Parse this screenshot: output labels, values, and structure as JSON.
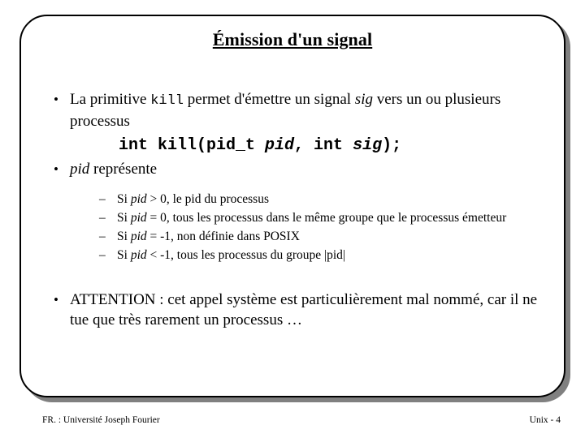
{
  "slide": {
    "title": "Émission d'un signal",
    "bullets": [
      {
        "marker": "•",
        "parts": [
          {
            "text": "La primitive ",
            "style": "normal"
          },
          {
            "text": "kill",
            "style": "mono"
          },
          {
            "text": " permet d'émettre un signal ",
            "style": "normal"
          },
          {
            "text": "sig",
            "style": "italic"
          },
          {
            "text": " vers un ou plusieurs processus",
            "style": "normal"
          }
        ]
      }
    ],
    "code_line": {
      "before": "int kill(pid_t ",
      "arg1": "pid",
      "middle": ", int ",
      "arg2": "sig",
      "after": ");"
    },
    "bullet2": {
      "marker": "•",
      "ital": "pid",
      "rest": " représente"
    },
    "sub_items": [
      {
        "dash": "–",
        "pre": "Si ",
        "ital": "pid",
        "post": " > 0, le pid du processus"
      },
      {
        "dash": "–",
        "pre": "Si ",
        "ital": "pid",
        "post": " = 0, tous les processus dans le même groupe que le processus émetteur"
      },
      {
        "dash": "–",
        "pre": "Si ",
        "ital": "pid",
        "post": " = -1, non définie dans POSIX"
      },
      {
        "dash": "–",
        "pre": "Si ",
        "ital": "pid",
        "post": " < -1, tous les processus du groupe |pid|"
      }
    ],
    "bullet3": {
      "marker": "•",
      "text": "ATTENTION : cet appel système est particulièrement mal nommé, car il ne tue que très rarement un processus …"
    },
    "footer_left": "FR. : Université Joseph Fourier",
    "footer_right": "Unix - 4"
  }
}
